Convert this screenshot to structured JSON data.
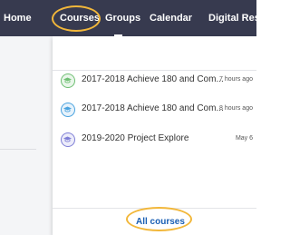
{
  "nav": {
    "items": [
      {
        "label": "Home"
      },
      {
        "label": "Courses"
      },
      {
        "label": "Groups"
      },
      {
        "label": "Calendar"
      },
      {
        "label": "Digital Resource"
      }
    ]
  },
  "courses_dropdown": {
    "items": [
      {
        "name": "2017-2018 Achieve 180 and Com...",
        "time": "7 hours ago",
        "icon": "course-cap-icon",
        "color": "#6fbf73"
      },
      {
        "name": "2017-2018 Achieve 180 and Com...",
        "time": "8 hours ago",
        "icon": "course-cap-icon",
        "color": "#4aa3df"
      },
      {
        "name": "2019-2020 Project Explore",
        "time": "May 6",
        "icon": "course-cap-icon",
        "color": "#7f7fd6"
      }
    ],
    "all_courses_label": "All courses"
  },
  "colors": {
    "nav_bg": "#373a4f",
    "link": "#1a5fb4",
    "annotation": "#f2b73a"
  }
}
